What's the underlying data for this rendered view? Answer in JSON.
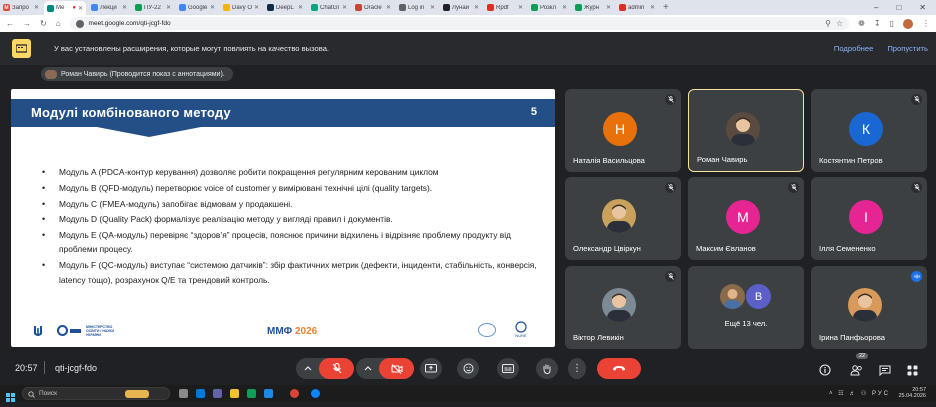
{
  "browser": {
    "tabs": [
      {
        "label": "Запро",
        "color": "#ea4335",
        "glyph": "M"
      },
      {
        "label": "Me",
        "color": "#00897b",
        "glyph": "",
        "active": true
      },
      {
        "label": "Лекци",
        "color": "#4285f4",
        "glyph": ""
      },
      {
        "label": "ПУ-22",
        "color": "#0f9d58",
        "glyph": ""
      },
      {
        "label": "Google",
        "color": "#4285f4",
        "glyph": ""
      },
      {
        "label": "Davy O",
        "color": "#f4b400",
        "glyph": ""
      },
      {
        "label": "DeepL",
        "color": "#0f2b46",
        "glyph": ""
      },
      {
        "label": "ChatGI",
        "color": "#10a37f",
        "glyph": ""
      },
      {
        "label": "Oracle",
        "color": "#c74634",
        "glyph": ""
      },
      {
        "label": "Log in",
        "color": "#5f6368",
        "glyph": ""
      },
      {
        "label": "Лунаи",
        "color": "#202124",
        "glyph": ""
      },
      {
        "label": "Rpdf",
        "color": "#d93025",
        "glyph": ""
      },
      {
        "label": "Розкл",
        "color": "#0f9d58",
        "glyph": ""
      },
      {
        "label": "Журн",
        "color": "#0f9d58",
        "glyph": ""
      },
      {
        "label": "admin",
        "color": "#d93025",
        "glyph": ""
      }
    ],
    "url": "meet.google.com/qti-jcgf-fdo"
  },
  "extension_warning": {
    "text": "У вас установлены расширения, которые могут повлиять на качество вызова.",
    "details": "Подробнее",
    "skip": "Пропустить"
  },
  "presenter_bar": {
    "text": "Роман Чавирь (Проводится показ с аннотациями)."
  },
  "slide": {
    "title": "Модулі комбінованого методу",
    "number": "5",
    "bullets": [
      "Модуль A (PDCA-контур керування) дозволяє робити покращення регулярним керованим циклом",
      "Модуль B (QFD-модуль) перетворює voice of customer у вимірювані технічні цілі (quality targets).",
      "Модуль C (FMEA-модуль) запобігає відмовам у продакшені.",
      "Модуль D (Quality Pack) формалізує реалізацію методу у вигляді правил і документів.",
      "Модуль E (QA-модуль) перевіряє “здоров’я” процесів, пояснює причини відхилень і відрізняє проблему продукту від проблеми процесу.",
      "Модуль F (QC-модуль) виступає “системою датчиків”: збір фактичних метрик (дефекти, інциденти, стабільність, конверсія, latency тощо), розрахунок Q/E та трендовий контроль."
    ],
    "footer_ministry": "МІНІСТЕРСТВО ОСВІТИ І НАУКИ УКРАЇНИ",
    "footer_conf_prefix": "ММФ ",
    "footer_conf_year": "2026",
    "footer_nure": "NURE"
  },
  "participants": [
    {
      "name": "Наталія Васильцова",
      "initial": "Н",
      "color": "#e8710a",
      "muted": true
    },
    {
      "name": "Роман Чавирь",
      "initial": "",
      "photo": "#5a4a40",
      "muted": false,
      "speaking": true
    },
    {
      "name": "Костянтин Петров",
      "initial": "К",
      "color": "#1967d2",
      "muted": true
    },
    {
      "name": "Олександр Цвіркун",
      "initial": "",
      "photo": "#c9a15a",
      "muted": true
    },
    {
      "name": "Максим Євланов",
      "initial": "М",
      "color": "#e52592",
      "muted": true
    },
    {
      "name": "Ілля Семененко",
      "initial": "І",
      "color": "#e52592",
      "muted": true
    },
    {
      "name": "Віктор Левикін",
      "initial": "",
      "photo": "#7c8a95",
      "muted": true
    },
    {
      "name": "Ещё 13 чел.",
      "initial": "В",
      "color": "#5b5fc7",
      "group": true
    },
    {
      "name": "Ірина Панфьорова",
      "initial": "",
      "photo": "#d79a5a",
      "muted": false
    }
  ],
  "meeting": {
    "time": "20:57",
    "code": "qti-jcgf-fdo",
    "participant_count": "22"
  },
  "taskbar": {
    "search_placeholder": "Поиск",
    "lang": "РУС",
    "time": "20:57",
    "date": "25.04.2026"
  }
}
